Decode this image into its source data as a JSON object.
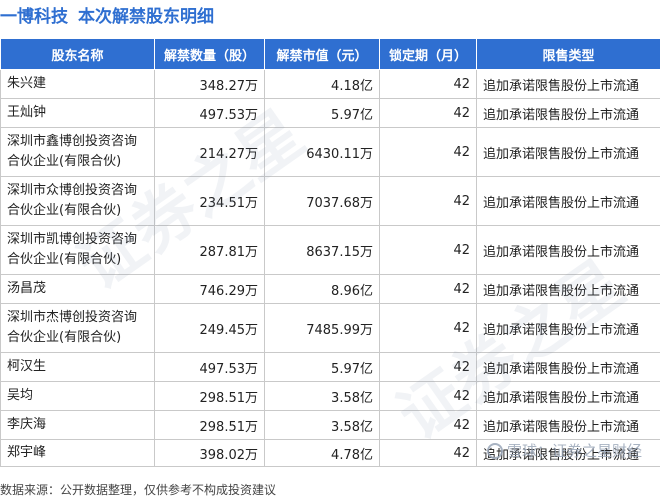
{
  "title": {
    "company": "一博科技",
    "subtitle": "本次解禁股东明细"
  },
  "table": {
    "headers": [
      "股东名称",
      "解禁数量（股）",
      "解禁市值（元）",
      "锁定期（月）",
      "限售类型"
    ],
    "rows": [
      {
        "name": "朱兴建",
        "qty": "348.27万",
        "value": "4.18亿",
        "lock": "42",
        "type": "追加承诺限售股份上市流通"
      },
      {
        "name": "王灿钟",
        "qty": "497.53万",
        "value": "5.97亿",
        "lock": "42",
        "type": "追加承诺限售股份上市流通"
      },
      {
        "name": "深圳市鑫博创投资咨询合伙企业(有限合伙)",
        "qty": "214.27万",
        "value": "6430.11万",
        "lock": "42",
        "type": "追加承诺限售股份上市流通"
      },
      {
        "name": "深圳市众博创投资咨询合伙企业(有限合伙)",
        "qty": "234.51万",
        "value": "7037.68万",
        "lock": "42",
        "type": "追加承诺限售股份上市流通"
      },
      {
        "name": "深圳市凯博创投资咨询合伙企业(有限合伙)",
        "qty": "287.81万",
        "value": "8637.15万",
        "lock": "42",
        "type": "追加承诺限售股份上市流通"
      },
      {
        "name": "汤昌茂",
        "qty": "746.29万",
        "value": "8.96亿",
        "lock": "42",
        "type": "追加承诺限售股份上市流通"
      },
      {
        "name": "深圳市杰博创投资咨询合伙企业(有限合伙)",
        "qty": "249.45万",
        "value": "7485.99万",
        "lock": "42",
        "type": "追加承诺限售股份上市流通"
      },
      {
        "name": "柯汉生",
        "qty": "497.53万",
        "value": "5.97亿",
        "lock": "42",
        "type": "追加承诺限售股份上市流通"
      },
      {
        "name": "吴均",
        "qty": "298.51万",
        "value": "3.58亿",
        "lock": "42",
        "type": "追加承诺限售股份上市流通"
      },
      {
        "name": "李庆海",
        "qty": "298.51万",
        "value": "3.58亿",
        "lock": "42",
        "type": "追加承诺限售股份上市流通"
      },
      {
        "name": "郑宇峰",
        "qty": "398.02万",
        "value": "4.78亿",
        "lock": "42",
        "type": "追加承诺限售股份上市流通"
      }
    ]
  },
  "source": "数据来源：公开数据整理，仅供参考不构成投资建议",
  "watermark": {
    "logo_text": "雪球：证券之星财经",
    "diagonal_text": "证券之星"
  },
  "colors": {
    "header_bg": "#2f6fd1",
    "title": "#2f6fd1"
  }
}
